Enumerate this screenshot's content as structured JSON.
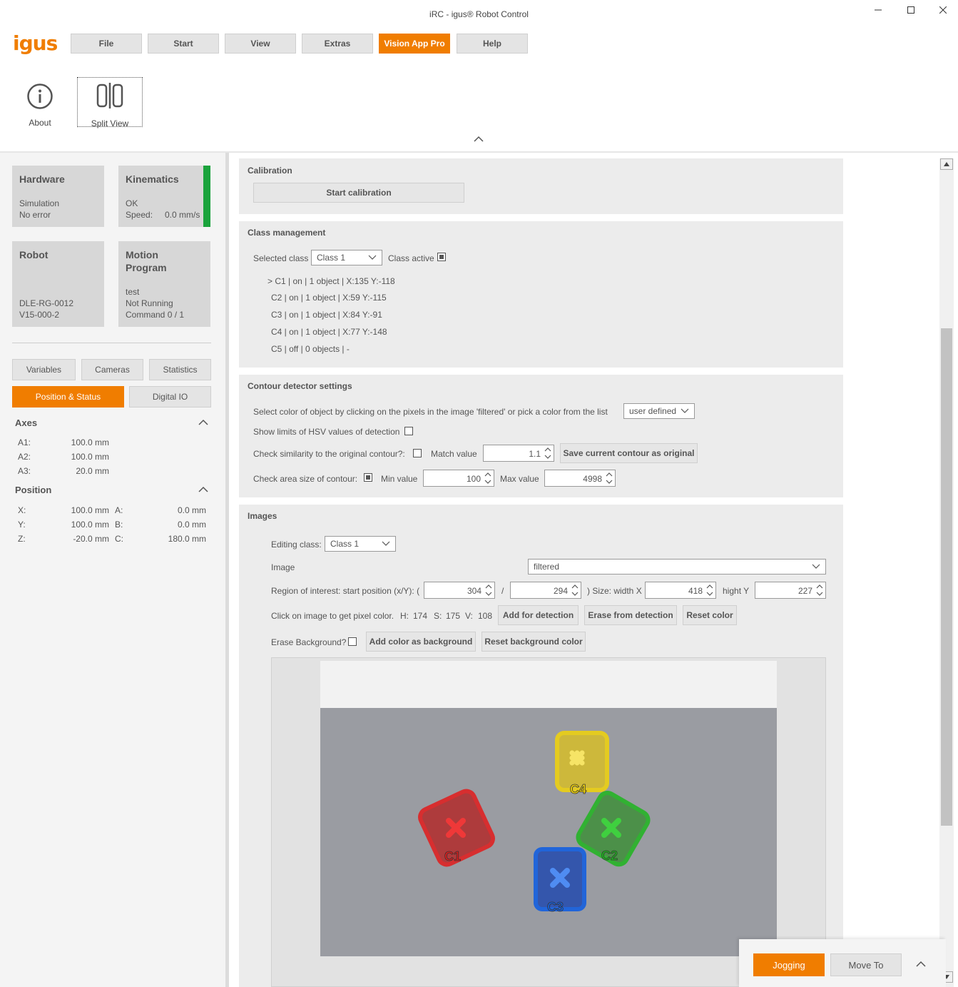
{
  "window": {
    "title": "iRC - igus® Robot Control"
  },
  "logo_text": "igus",
  "menu": {
    "file": "File",
    "start": "Start",
    "view": "View",
    "extras": "Extras",
    "vision": "Vision App Pro",
    "help": "Help"
  },
  "ribbon": {
    "about": "About",
    "split_view": "Split View"
  },
  "tiles": {
    "hardware": {
      "title": "Hardware",
      "l1": "Simulation",
      "l2": "No error"
    },
    "kinematics": {
      "title": "Kinematics",
      "l1": "OK",
      "l2": "Speed:",
      "speed": "0.0 mm/s",
      "status_color": "#1aa33c"
    },
    "robot": {
      "title": "Robot",
      "l1": "DLE-RG-0012",
      "l2": "V15-000-2"
    },
    "motion": {
      "title1": "Motion",
      "title2": "Program",
      "l1": "test",
      "l2": "Not Running",
      "l3": "Command 0 / 1"
    }
  },
  "left_tabs": {
    "variables": "Variables",
    "cameras": "Cameras",
    "statistics": "Statistics",
    "position": "Position & Status",
    "digital": "Digital IO"
  },
  "axes": {
    "title": "Axes",
    "rows": [
      {
        "label": "A1:",
        "value": "100.0 mm"
      },
      {
        "label": "A2:",
        "value": "100.0 mm"
      },
      {
        "label": "A3:",
        "value": "20.0 mm"
      }
    ]
  },
  "position": {
    "title": "Position",
    "rows": [
      {
        "l1": "X:",
        "v1": "100.0 mm",
        "l2": "A:",
        "v2": "0.0 mm"
      },
      {
        "l1": "Y:",
        "v1": "100.0 mm",
        "l2": "B:",
        "v2": "0.0 mm"
      },
      {
        "l1": "Z:",
        "v1": "-20.0 mm",
        "l2": "C:",
        "v2": "180.0 mm"
      }
    ]
  },
  "calibration": {
    "title": "Calibration",
    "button": "Start calibration"
  },
  "class_mgmt": {
    "title": "Class management",
    "selected_label": "Selected class",
    "selected_value": "Class 1",
    "active_label": "Class active",
    "classes": [
      "> C1 | on | 1 object | X:135 Y:-118",
      "C2 | on | 1 object | X:59 Y:-115",
      "C3 | on | 1 object | X:84 Y:-91",
      "C4 | on | 1 object | X:77 Y:-148",
      "C5 | off | 0 objects | -"
    ]
  },
  "contour": {
    "title": "Contour detector settings",
    "select_color_label": "Select color of object by clicking on the pixels in the image 'filtered' or pick a color from the list",
    "color_value": "user defined",
    "hsv_label": "Show limits of HSV values of detection",
    "similarity_label": "Check similarity to the original contour?:",
    "match_label": "Match value",
    "match_value": "1.1",
    "save_btn": "Save current contour as original",
    "area_label": "Check area size of contour:",
    "min_label": "Min value",
    "min_value": "100",
    "max_label": "Max value",
    "max_value": "4998"
  },
  "images": {
    "title": "Images",
    "editing_label": "Editing class:",
    "editing_value": "Class 1",
    "image_label": "Image",
    "image_value": "filtered",
    "roi_label": "Region of interest: start position (x/Y): (",
    "roi_x": "304",
    "slash": "/",
    "roi_y": "294",
    "size_label": ") Size: width X",
    "width": "418",
    "hight_label": "hight Y",
    "height": "227",
    "pixel_label": "Click on image to get pixel color.",
    "h_label": "H:",
    "h": "174",
    "s_label": "S:",
    "s": "175",
    "v_label": "V:",
    "v": "108",
    "add_btn": "Add for detection",
    "erase_btn": "Erase from detection",
    "reset_btn": "Reset color",
    "erase_bg_label": "Erase Background?",
    "add_bg_btn": "Add color as background",
    "reset_bg_btn": "Reset background color",
    "object_labels": [
      "C1",
      "C2",
      "C3",
      "C4"
    ],
    "colors": {
      "c1": "#e21b1b",
      "c2": "#1fb51f",
      "c3": "#1560e0",
      "c4": "#f2d40a",
      "bg": "#9a9ca2"
    }
  },
  "bottom": {
    "jogging": "Jogging",
    "moveto": "Move To"
  },
  "accent": "#f07d00"
}
